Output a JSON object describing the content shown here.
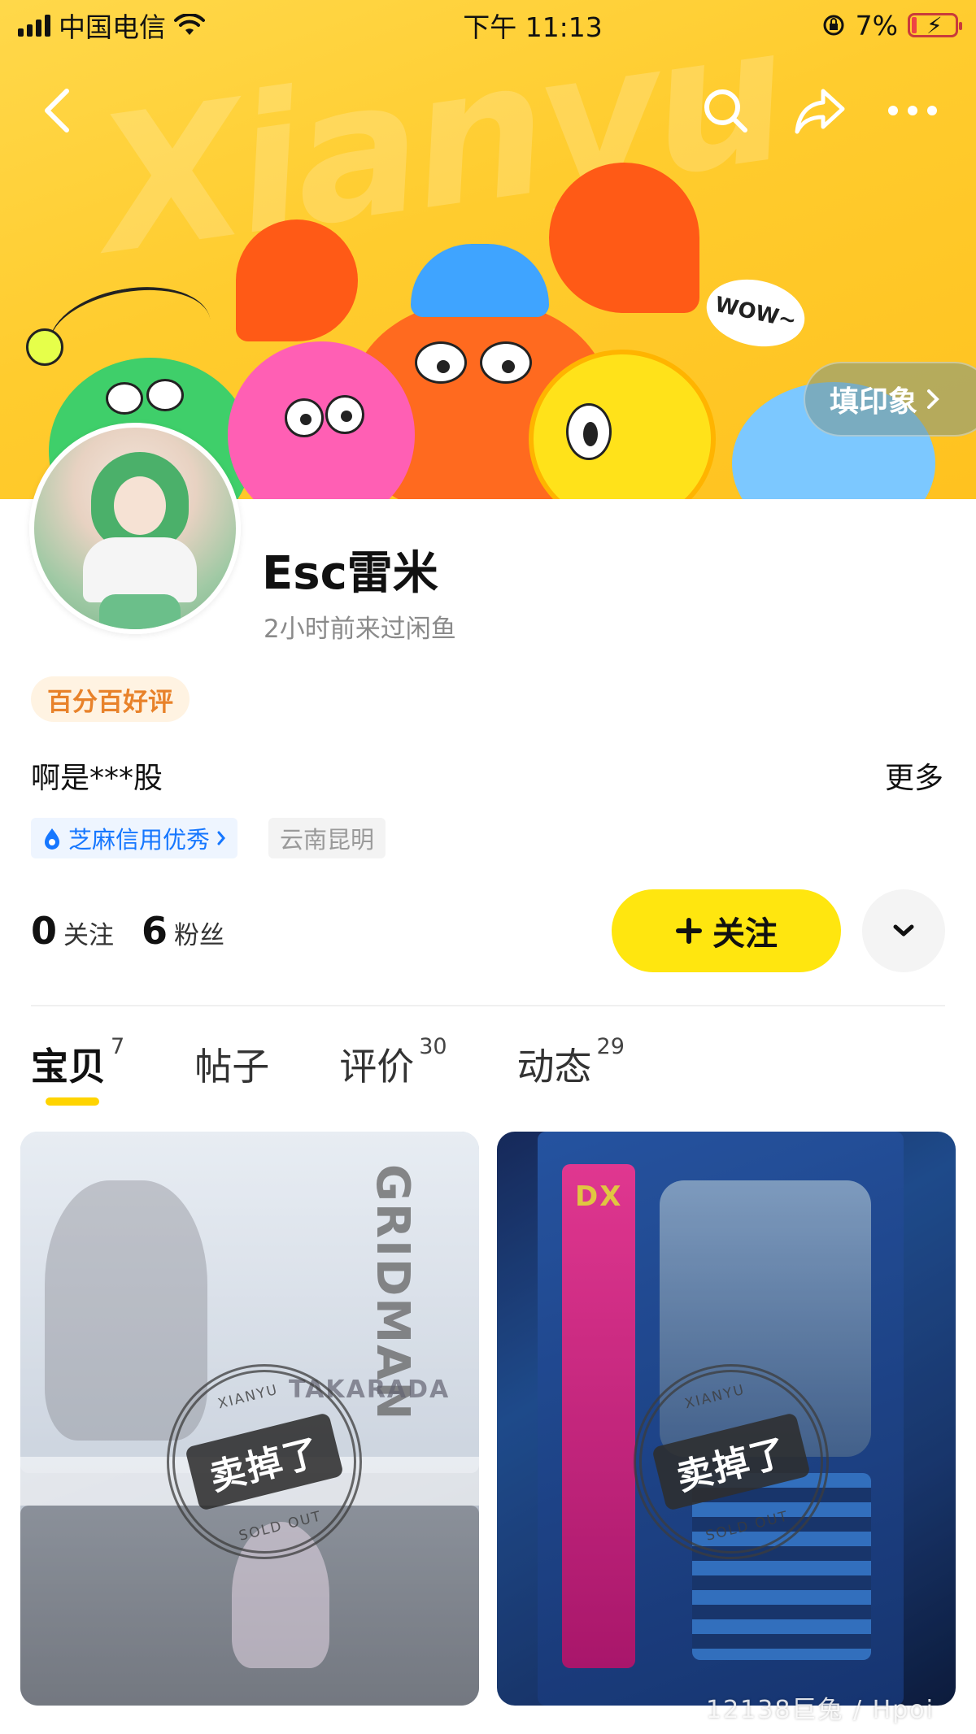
{
  "status_bar": {
    "carrier": "中国电信",
    "time": "下午 11:13",
    "battery": "7%"
  },
  "header": {
    "impression_button": "填印象",
    "banner_speech": "WOW~"
  },
  "profile": {
    "name": "Esc雷米",
    "last_seen": "2小时前来过闲鱼",
    "rating_badge": "百分百好评",
    "bio": "啊是***股",
    "bio_more": "更多",
    "credit_tag": "芝麻信用优秀",
    "location_tag": "云南昆明"
  },
  "stats": {
    "following_count": "0",
    "following_label": "关注",
    "followers_count": "6",
    "followers_label": "粉丝"
  },
  "actions": {
    "follow_label": "关注"
  },
  "tabs": [
    {
      "label": "宝贝",
      "count": "7",
      "active": true
    },
    {
      "label": "帖子",
      "count": "",
      "active": false
    },
    {
      "label": "评价",
      "count": "30",
      "active": false
    },
    {
      "label": "动态",
      "count": "29",
      "active": false
    }
  ],
  "products": [
    {
      "stamp_text": "卖掉了",
      "stamp_top": "XIANYU",
      "stamp_bottom": "SOLD OUT",
      "box_text": "GRIDMAN",
      "box_text_2": "TAKARADA"
    },
    {
      "stamp_text": "卖掉了",
      "stamp_top": "XIANYU",
      "stamp_bottom": "SOLD OUT",
      "box_text": "DX"
    }
  ],
  "watermark": "12138巨兔 / Hpoi",
  "colors": {
    "accent_yellow": "#ffe60f",
    "banner_yellow": "#ffcc2e",
    "credit_blue": "#1677ff",
    "rating_orange": "#e8822a"
  },
  "icons": [
    "back-icon",
    "search-icon",
    "share-icon",
    "more-icon",
    "chevron-right-icon",
    "chevron-down-icon",
    "plus-icon",
    "sesame-icon",
    "wifi-icon",
    "signal-icon",
    "battery-icon",
    "lock-rotation-icon"
  ]
}
